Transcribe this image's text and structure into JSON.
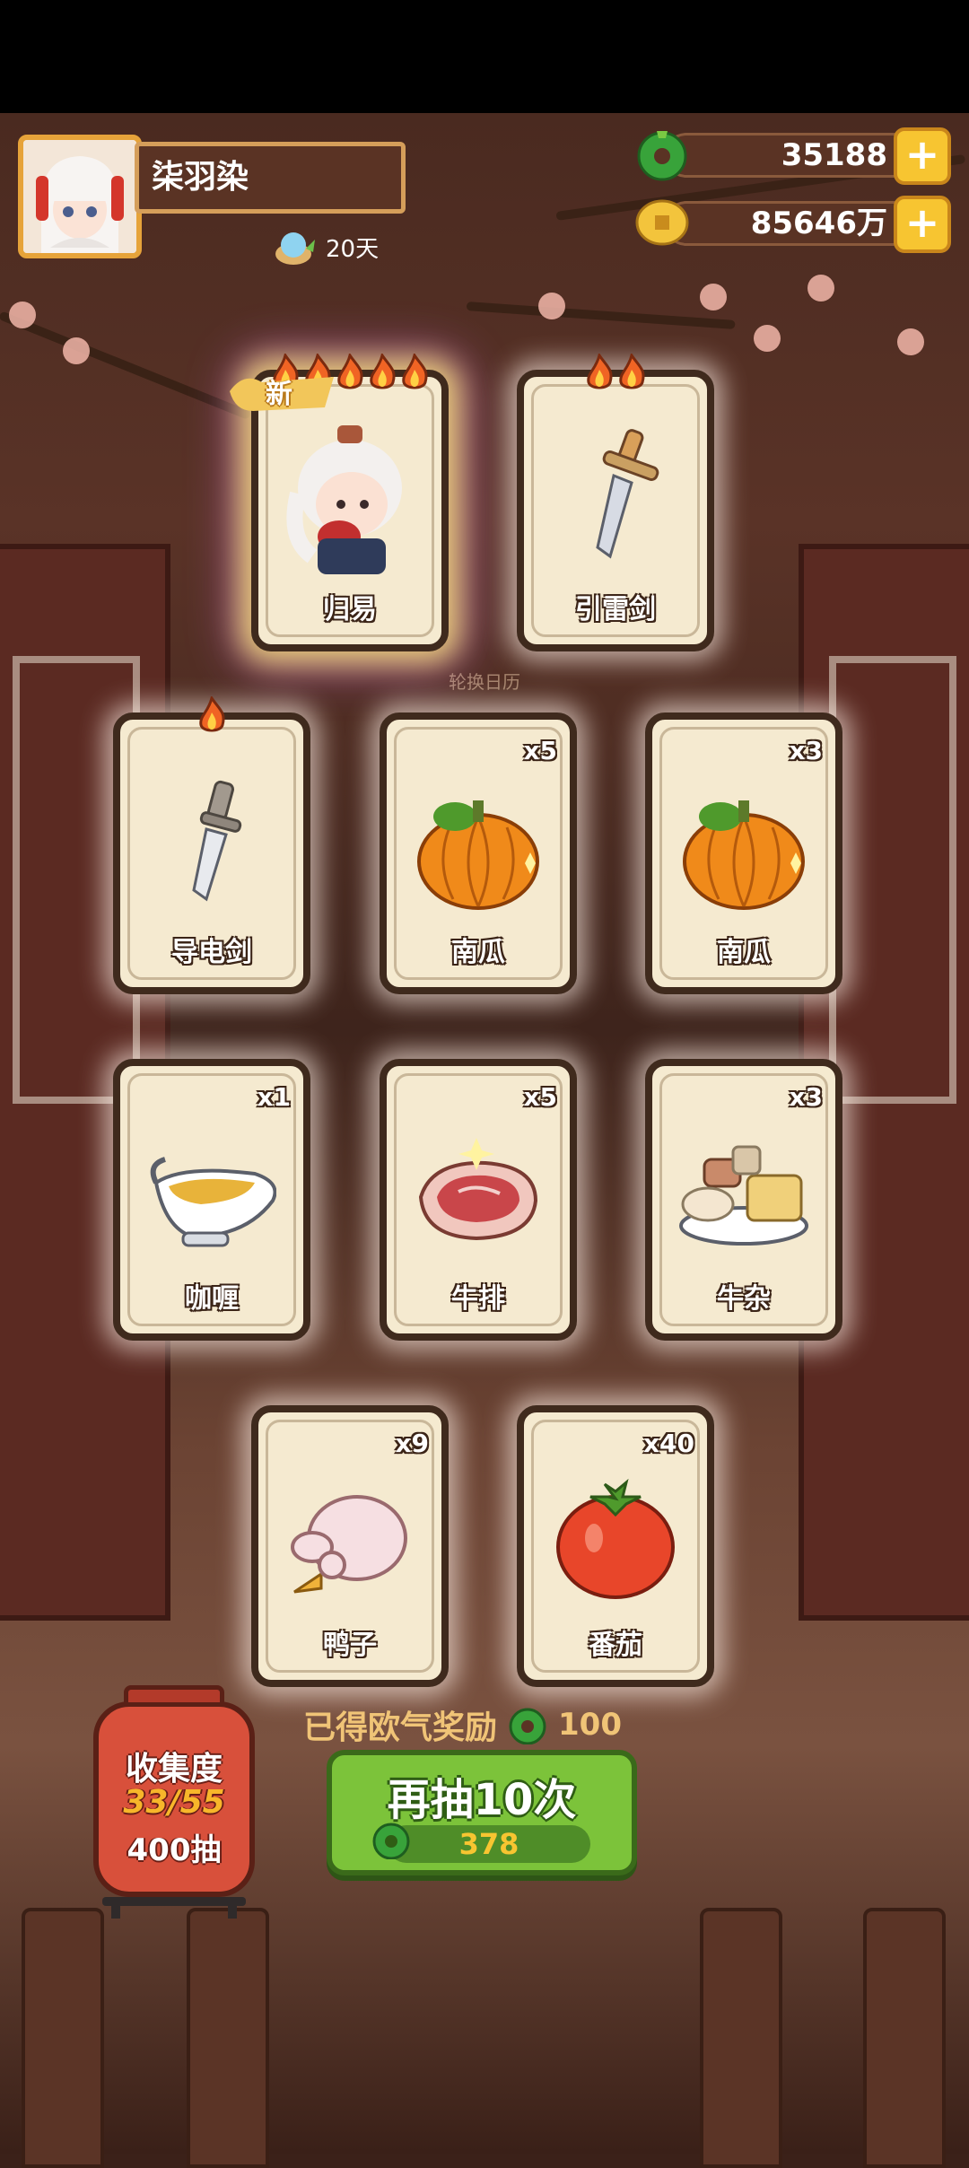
{
  "player": {
    "name": "柒羽染",
    "days": "20天"
  },
  "currency": {
    "jade": "35188",
    "coins": "85646万"
  },
  "center_text": "轮换日历",
  "cards": [
    {
      "label": "归易",
      "qty": "",
      "flames": 5,
      "is_new": true,
      "new_text": "新",
      "icon": "chef-character"
    },
    {
      "label": "引雷剑",
      "qty": "",
      "flames": 2,
      "is_new": false,
      "icon": "sword-icon"
    },
    {
      "label": "导电剑",
      "qty": "",
      "flames": 1,
      "is_new": false,
      "icon": "dagger-icon"
    },
    {
      "label": "南瓜",
      "qty": "x5",
      "flames": 0,
      "is_new": false,
      "icon": "pumpkin-icon"
    },
    {
      "label": "南瓜",
      "qty": "x3",
      "flames": 0,
      "is_new": false,
      "icon": "pumpkin-icon"
    },
    {
      "label": "咖喱",
      "qty": "x1",
      "flames": 0,
      "is_new": false,
      "icon": "curry-gravy-boat-icon"
    },
    {
      "label": "牛排",
      "qty": "x5",
      "flames": 0,
      "is_new": false,
      "icon": "steak-icon"
    },
    {
      "label": "牛杂",
      "qty": "x3",
      "flames": 0,
      "is_new": false,
      "icon": "beef-offal-icon"
    },
    {
      "label": "鸭子",
      "qty": "x9",
      "flames": 0,
      "is_new": false,
      "icon": "duck-icon"
    },
    {
      "label": "番茄",
      "qty": "x40",
      "flames": 0,
      "is_new": false,
      "icon": "tomato-icon"
    }
  ],
  "collection": {
    "title": "收集度",
    "progress": "33/55",
    "draws": "400抽"
  },
  "reward": {
    "text": "已得欧气奖励",
    "value": "100"
  },
  "draw_button": {
    "label": "再抽10次",
    "cost": "378"
  },
  "colors": {
    "button_green": "#7cc33a",
    "gold": "#f7c531",
    "card_bg": "#f5ead0"
  }
}
